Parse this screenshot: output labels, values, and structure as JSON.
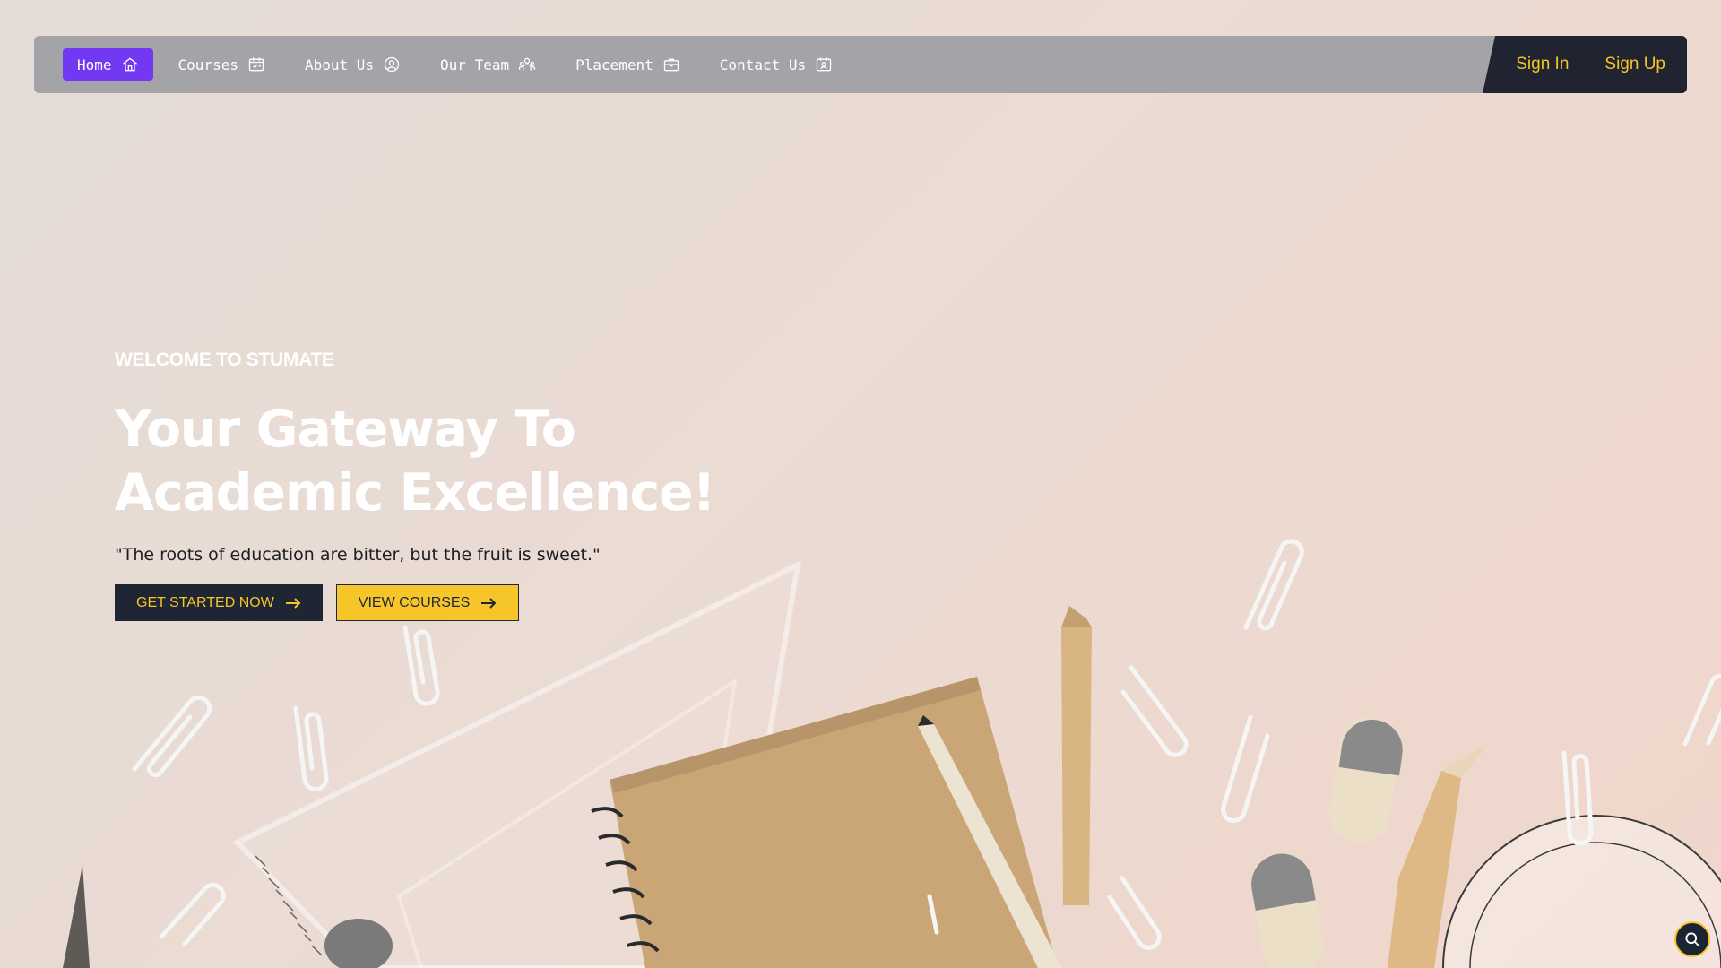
{
  "nav": {
    "items": [
      {
        "label": "Home",
        "icon": "home-icon",
        "active": true
      },
      {
        "label": "Courses",
        "icon": "calendar-check-icon",
        "active": false
      },
      {
        "label": "About Us",
        "icon": "user-circle-icon",
        "active": false
      },
      {
        "label": "Our Team",
        "icon": "team-icon",
        "active": false
      },
      {
        "label": "Placement",
        "icon": "briefcase-icon",
        "active": false
      },
      {
        "label": "Contact Us",
        "icon": "contact-card-icon",
        "active": false
      }
    ],
    "sign_in": "Sign In",
    "sign_up": "Sign Up"
  },
  "hero": {
    "eyebrow": "WELCOME TO STUMATE",
    "headline_line1": "Your Gateway To",
    "headline_line2": "Academic Excellence!",
    "quote": "\"The roots of education are bitter, but the fruit is sweet.\"",
    "cta_primary": "GET STARTED NOW",
    "cta_secondary": "VIEW COURSES"
  },
  "search_fab": {
    "icon": "search-icon"
  },
  "colors": {
    "accent_purple": "#7338f2",
    "accent_yellow": "#f6c52a",
    "navy": "#1f2633",
    "navbar_gray": "#a4a3a7"
  }
}
